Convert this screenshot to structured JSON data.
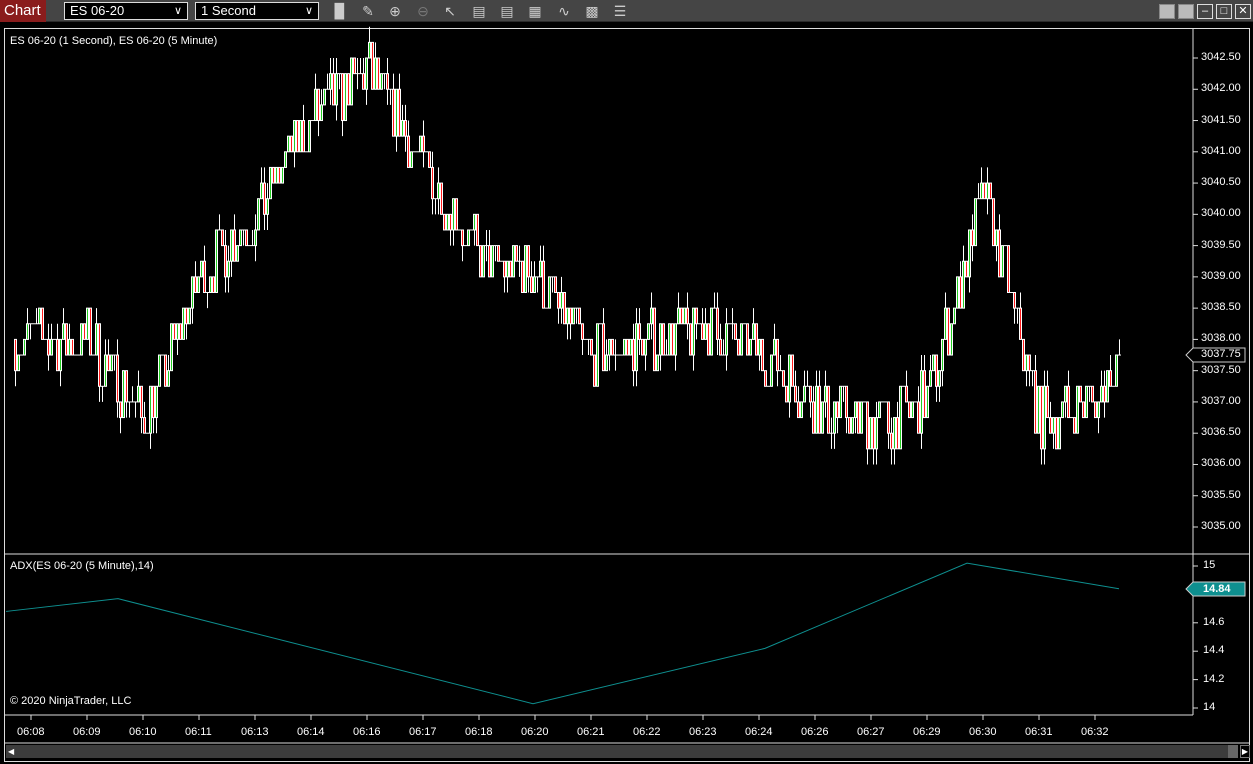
{
  "toolbar": {
    "chart_label": "Chart",
    "instrument": "ES 06-20",
    "interval": "1 Second",
    "icons": [
      "bars-type-icon",
      "pencil-draw-icon",
      "zoom-in-icon",
      "zoom-out-icon",
      "pointer-icon",
      "data-box-icon",
      "properties-icon",
      "chart-trader-icon",
      "strategies-icon",
      "indicators-icon",
      "list-icon"
    ],
    "window_buttons": [
      "tile-icon",
      "tile-icon",
      "minimize-icon",
      "maximize-icon",
      "close-icon"
    ]
  },
  "price_panel": {
    "title": "ES 06-20 (1 Second), ES 06-20 (5 Minute)",
    "current_price": "3037.75",
    "y_ticks": [
      "3042.50",
      "3042.00",
      "3041.50",
      "3041.00",
      "3040.50",
      "3040.00",
      "3039.50",
      "3039.00",
      "3038.50",
      "3038.00",
      "3037.50",
      "3037.00",
      "3036.50",
      "3036.00",
      "3035.50",
      "3035.00"
    ]
  },
  "adx_panel": {
    "title": "ADX(ES 06-20 (5 Minute),14)",
    "current_value": "14.84",
    "y_ticks": [
      "15",
      "14.6",
      "14.4",
      "14.2",
      "14"
    ],
    "copyright": "© 2020 NinjaTrader, LLC"
  },
  "time_axis": {
    "labels": [
      "06:08",
      "06:09",
      "06:10",
      "06:11",
      "06:13",
      "06:14",
      "06:16",
      "06:17",
      "06:18",
      "06:20",
      "06:21",
      "06:22",
      "06:23",
      "06:24",
      "06:26",
      "06:27",
      "06:29",
      "06:30",
      "06:31",
      "06:32"
    ]
  },
  "colors": {
    "up": "#22cc22",
    "down": "#ff1a1a",
    "outline": "#ffffff",
    "adx": "#0e8f8f",
    "background": "#000000",
    "chart_tab": "#8a1c1c"
  },
  "chart_data": [
    {
      "type": "candlestick",
      "name": "ES 06-20 (1 Second)",
      "ylim": [
        3035.0,
        3042.5
      ],
      "tick_size": 0.25,
      "approx_price_at_time": [
        {
          "t": "06:08",
          "price": 3038.0
        },
        {
          "t": "06:09",
          "price": 3038.0
        },
        {
          "t": "06:10",
          "price": 3036.7
        },
        {
          "t": "06:11",
          "price": 3039.0
        },
        {
          "t": "06:13",
          "price": 3040.0
        },
        {
          "t": "06:14",
          "price": 3041.5
        },
        {
          "t": "06:16",
          "price": 3042.3
        },
        {
          "t": "06:17",
          "price": 3040.8
        },
        {
          "t": "06:18",
          "price": 3039.3
        },
        {
          "t": "06:20",
          "price": 3039.0
        },
        {
          "t": "06:21",
          "price": 3037.7
        },
        {
          "t": "06:22",
          "price": 3038.0
        },
        {
          "t": "06:23",
          "price": 3038.2
        },
        {
          "t": "06:24",
          "price": 3037.8
        },
        {
          "t": "06:26",
          "price": 3037.0
        },
        {
          "t": "06:27",
          "price": 3036.6
        },
        {
          "t": "06:29",
          "price": 3037.0
        },
        {
          "t": "06:30",
          "price": 3040.4
        },
        {
          "t": "06:31",
          "price": 3036.7
        },
        {
          "t": "06:32",
          "price": 3037.0
        }
      ],
      "last": 3037.75
    },
    {
      "type": "line",
      "name": "ADX(ES 06-20 (5 Minute),14)",
      "ylim": [
        14,
        15
      ],
      "points": [
        {
          "t": "06:08",
          "v": 14.68
        },
        {
          "t": "06:09",
          "v": 14.77
        },
        {
          "t": "06:20",
          "v": 14.03
        },
        {
          "t": "06:24",
          "v": 14.42
        },
        {
          "t": "06:30",
          "v": 15.02
        },
        {
          "t": "06:32",
          "v": 14.84
        }
      ]
    }
  ]
}
